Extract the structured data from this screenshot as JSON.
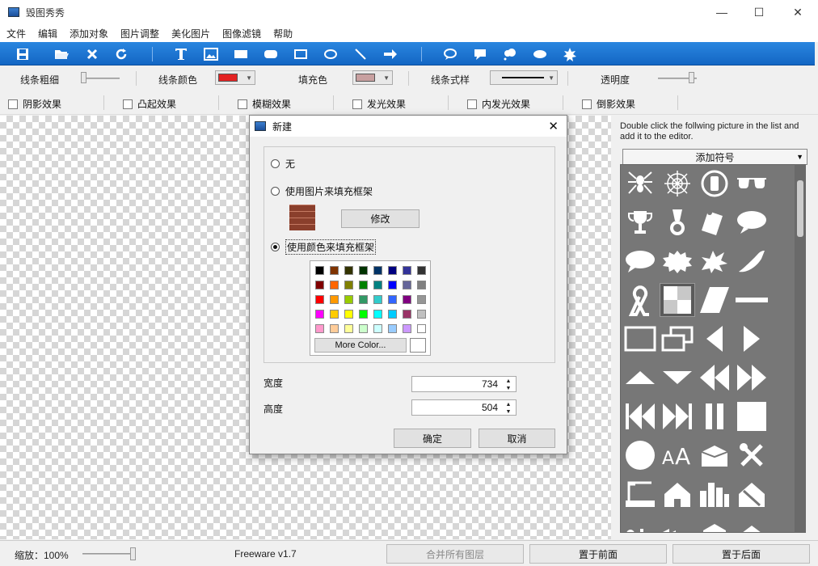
{
  "window": {
    "title": "毁图秀秀",
    "minimize": "—",
    "maximize": "☐",
    "close": "✕"
  },
  "menu": [
    "文件",
    "编辑",
    "添加对象",
    "图片调整",
    "美化图片",
    "图像滤镜",
    "帮助"
  ],
  "toolbar_icons": [
    "save-icon",
    "open-folder-icon",
    "delete-icon",
    "refresh-icon",
    "text-icon",
    "image-icon",
    "rect-filled-icon",
    "rounded-rect-icon",
    "rect-outline-icon",
    "ellipse-icon",
    "line-icon",
    "arrow-icon",
    "speech-bubble-icon",
    "rect-callout-icon",
    "cloud-callout-icon",
    "cloud-icon",
    "star-burst-icon"
  ],
  "props": {
    "line_width": "线条粗细",
    "line_color": "线条颜色",
    "line_color_value": "#e32222",
    "fill_color": "填充色",
    "fill_color_value": "#c8a0a0",
    "line_style": "线条式样",
    "opacity": "透明度"
  },
  "effects": [
    "阴影效果",
    "凸起效果",
    "模糊效果",
    "发光效果",
    "内发光效果",
    "倒影效果"
  ],
  "right_panel": {
    "hint": "Double click the follwing picture in the list and add it to the editor.",
    "dropdown": "添加符号"
  },
  "gallery_icons": [
    "spider-icon",
    "spider-web-icon",
    "no-phone-icon",
    "glasses-icon",
    "trophy-icon",
    "medal-icon",
    "scroll-icon",
    "speech-oval-icon",
    "speech-cloud-icon",
    "burst-icon",
    "explosion-icon",
    "chili-icon",
    "ribbon-icon",
    "checker-icon",
    "parallelogram-icon",
    "minus-icon",
    "rect-frame-icon",
    "double-rect-icon",
    "triangle-left-icon",
    "triangle-right-icon",
    "triangle-up-icon",
    "triangle-down-icon",
    "rewind-icon",
    "fast-forward-icon",
    "skip-back-icon",
    "skip-forward-icon",
    "pause-icon",
    "stop-icon",
    "circle-icon",
    "font-size-icon",
    "box-icon",
    "tools-icon",
    "crane-icon",
    "house-icon",
    "city-icon",
    "house-damaged-icon"
  ],
  "dialog": {
    "title": "新建",
    "opt_none": "无",
    "opt_image": "使用图片来填充框架",
    "modify": "修改",
    "opt_color": "使用颜色来填充框架",
    "more_color": "More Color...",
    "width_label": "宽度",
    "width_value": "734",
    "height_label": "高度",
    "height_value": "504",
    "ok": "确定",
    "cancel": "取消",
    "palette": [
      [
        "#000000",
        "#7f3300",
        "#333300",
        "#003300",
        "#003366",
        "#000080",
        "#333399",
        "#333333"
      ],
      [
        "#800000",
        "#ff6600",
        "#808000",
        "#008000",
        "#008080",
        "#0000ff",
        "#666699",
        "#808080"
      ],
      [
        "#ff0000",
        "#ff9900",
        "#99cc00",
        "#339966",
        "#33cccc",
        "#3366ff",
        "#800080",
        "#969696"
      ],
      [
        "#ff00ff",
        "#ffcc00",
        "#ffff00",
        "#00ff00",
        "#00ffff",
        "#00ccff",
        "#993366",
        "#c0c0c0"
      ],
      [
        "#ff99cc",
        "#ffcc99",
        "#ffff99",
        "#ccffcc",
        "#ccffff",
        "#99ccff",
        "#cc99ff",
        "#ffffff"
      ]
    ]
  },
  "status": {
    "zoom": "缩放：100%",
    "version": "Freeware v1.7",
    "merge": "合并所有图层",
    "front": "置于前面",
    "back": "置于后面"
  }
}
